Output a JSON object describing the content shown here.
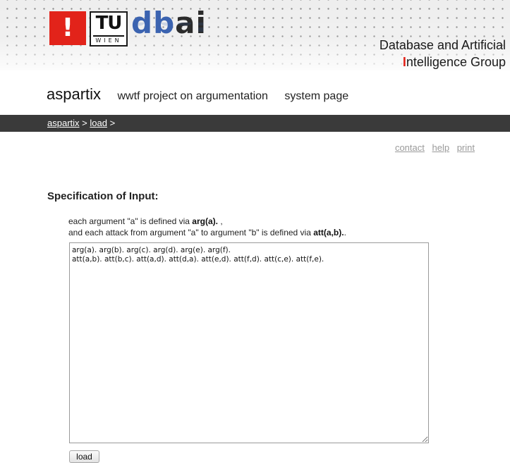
{
  "header": {
    "logo_exclamation": "!",
    "tu_logo_top": "TU",
    "tu_logo_bottom": "WIEN",
    "dbai_logo_db": "db",
    "dbai_logo_ai": "ai",
    "group_line1": "Database and Artificial",
    "group_line2_mark": "I",
    "group_line2_rest": "ntelligence Group"
  },
  "nav": {
    "site_title": "aspartix",
    "links": [
      "wwtf project on argumentation",
      "system page"
    ]
  },
  "breadcrumb": {
    "items": [
      "aspartix",
      "load"
    ],
    "separator": ">"
  },
  "util_links": [
    "contact",
    "help",
    "print"
  ],
  "content": {
    "heading": "Specification of Input:",
    "line1_prefix": "each argument \"a\" is defined via ",
    "line1_bold": "arg(a).",
    "line1_suffix": " ,",
    "line2_prefix": "and each attack from argument \"a\" to argument \"b\" is defined via ",
    "line2_bold": "att(a,b).",
    "line2_suffix": ".",
    "textarea_value": "arg(a). arg(b). arg(c). arg(d). arg(e). arg(f).\natt(a,b). att(b,c). att(a,d). att(d,a). att(e,d). att(f,d). att(c,e). att(f,e).",
    "load_button": "load"
  },
  "colors": {
    "brand_red": "#e2231a",
    "dbai_blue": "#3b63b0",
    "crumb_bar": "#3a3a3a",
    "util_link": "#9a9a9a"
  },
  "icons": [
    "exclamation-logo-icon",
    "tu-wien-logo-icon",
    "dbai-logo-icon",
    "textarea-resize-grip-icon"
  ]
}
